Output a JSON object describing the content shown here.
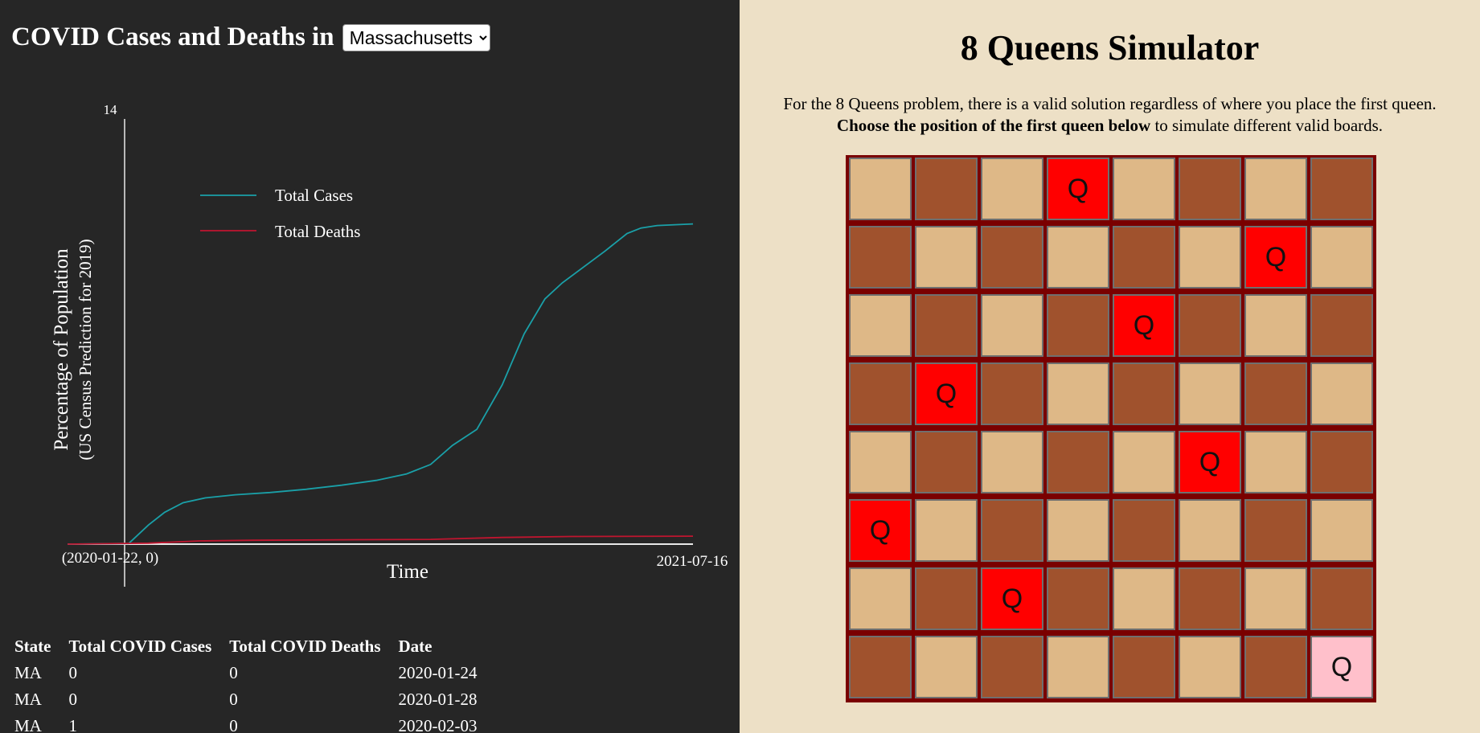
{
  "covid": {
    "title": "COVID Cases and Deaths in",
    "selected_state": "Massachusetts",
    "table": {
      "headers": [
        "State",
        "Total COVID Cases",
        "Total COVID Deaths",
        "Date"
      ],
      "rows": [
        [
          "MA",
          "0",
          "0",
          "2020-01-24"
        ],
        [
          "MA",
          "0",
          "0",
          "2020-01-28"
        ],
        [
          "MA",
          "1",
          "0",
          "2020-02-03"
        ]
      ]
    }
  },
  "chart_data": {
    "type": "line",
    "xlabel": "Time",
    "ylabel": "Percentage of Population",
    "ylabel_sub": "(US Census Prediction for 2019)",
    "ymax_label": "14",
    "ylim": [
      0,
      14
    ],
    "x_start_label": "(2020-01-22, 0)",
    "x_end_label": "2021-07-16",
    "xlim": [
      "2020-01-22",
      "2021-07-16"
    ],
    "legend_position": "top-left",
    "series": [
      {
        "name": "Total Cases",
        "color": "#1aa0a8",
        "points": [
          [
            "2020-01-22",
            0
          ],
          [
            "2020-03-15",
            0.02
          ],
          [
            "2020-04-01",
            0.6
          ],
          [
            "2020-04-15",
            1.0
          ],
          [
            "2020-05-01",
            1.3
          ],
          [
            "2020-05-20",
            1.45
          ],
          [
            "2020-06-15",
            1.55
          ],
          [
            "2020-07-15",
            1.62
          ],
          [
            "2020-08-15",
            1.72
          ],
          [
            "2020-09-15",
            1.85
          ],
          [
            "2020-10-15",
            2.0
          ],
          [
            "2020-11-10",
            2.2
          ],
          [
            "2020-12-01",
            2.5
          ],
          [
            "2020-12-20",
            3.1
          ],
          [
            "2021-01-10",
            3.6
          ],
          [
            "2021-02-01",
            5.0
          ],
          [
            "2021-02-20",
            6.6
          ],
          [
            "2021-03-10",
            7.7
          ],
          [
            "2021-03-25",
            8.2
          ],
          [
            "2021-05-01",
            9.2
          ],
          [
            "2021-05-20",
            9.75
          ],
          [
            "2021-06-01",
            9.92
          ],
          [
            "2021-06-15",
            10.0
          ],
          [
            "2021-07-16",
            10.05
          ]
        ]
      },
      {
        "name": "Total Deaths",
        "color": "#c0152f",
        "points": [
          [
            "2020-01-22",
            0
          ],
          [
            "2020-04-01",
            0.03
          ],
          [
            "2020-05-15",
            0.1
          ],
          [
            "2020-07-01",
            0.12
          ],
          [
            "2020-10-01",
            0.14
          ],
          [
            "2020-12-01",
            0.15
          ],
          [
            "2021-02-01",
            0.21
          ],
          [
            "2021-04-01",
            0.24
          ],
          [
            "2021-07-16",
            0.25
          ]
        ]
      }
    ]
  },
  "queens": {
    "title": "8 Queens Simulator",
    "desc_line1": "For the 8 Queens problem, there is a valid solution regardless of where you place the first queen.",
    "desc_bold": "Choose the position of the first queen below",
    "desc_rest": " to simulate different valid boards.",
    "queen_label": "Q",
    "queen_positions": [
      [
        0,
        3
      ],
      [
        1,
        6
      ],
      [
        2,
        4
      ],
      [
        3,
        1
      ],
      [
        4,
        5
      ],
      [
        5,
        0
      ],
      [
        6,
        2
      ],
      [
        7,
        7
      ]
    ],
    "first_queen": [
      7,
      7
    ],
    "colors": {
      "light": "#deb887",
      "dark": "#a0522d",
      "queen": "#ff0000",
      "first_queen": "#ffc0cb",
      "border": "#7a0000"
    }
  }
}
